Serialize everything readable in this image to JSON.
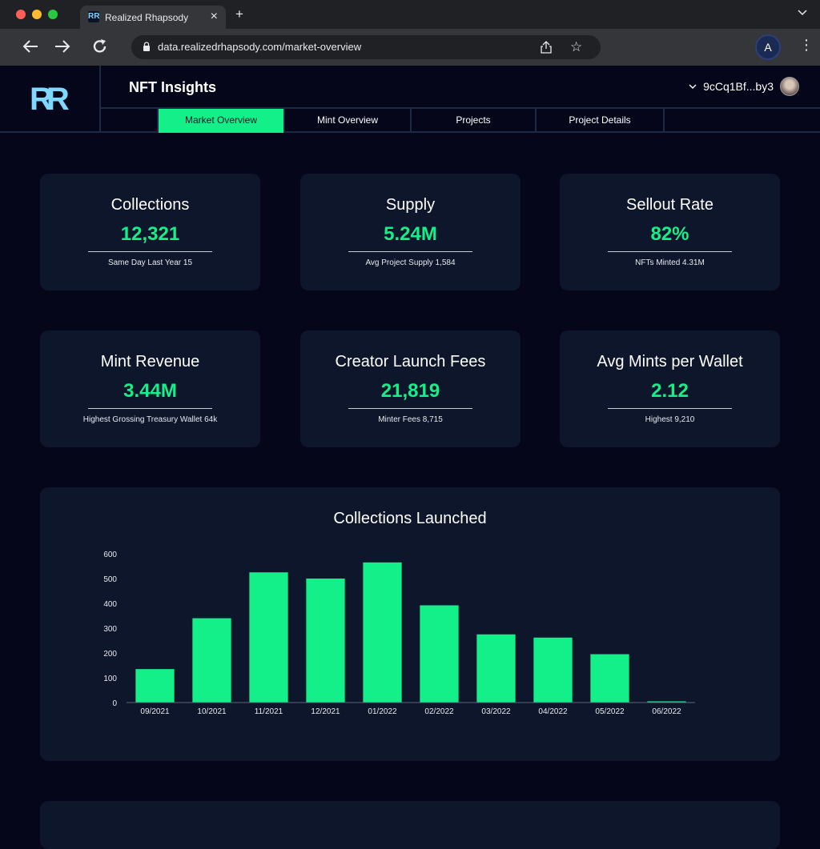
{
  "browser": {
    "tab_title": "Realized Rhapsody",
    "tab_favicon": "RR",
    "url": "data.realizedrhapsody.com/market-overview",
    "profile_initial": "A",
    "colors": {
      "close": "#ff5f57",
      "minimize": "#febc2e",
      "maximize": "#28c840"
    }
  },
  "header": {
    "logo": "RR",
    "title": "NFT Insights",
    "wallet": "9cCq1Bf...by3"
  },
  "nav": {
    "tabs": [
      {
        "label": "Market Overview",
        "active": true
      },
      {
        "label": "Mint Overview",
        "active": false
      },
      {
        "label": "Projects",
        "active": false
      },
      {
        "label": "Project Details",
        "active": false
      }
    ]
  },
  "stats": [
    {
      "title": "Collections",
      "value": "12,321",
      "sub": "Same Day Last Year 15"
    },
    {
      "title": "Supply",
      "value": "5.24M",
      "sub": "Avg Project Supply 1,584"
    },
    {
      "title": "Sellout Rate",
      "value": "82%",
      "sub": "NFTs Minted 4.31M"
    },
    {
      "title": "Mint Revenue",
      "value": "3.44M",
      "sub": "Highest Grossing Treasury Wallet 64k"
    },
    {
      "title": "Creator Launch Fees",
      "value": "21,819",
      "sub": "Minter Fees 8,715"
    },
    {
      "title": "Avg Mints per Wallet",
      "value": "2.12",
      "sub": "Highest 9,210"
    }
  ],
  "accent_color": "#14f089",
  "chart_data": {
    "type": "bar",
    "title": "Collections Launched",
    "categories": [
      "09/2021",
      "10/2021",
      "11/2021",
      "12/2021",
      "01/2022",
      "02/2022",
      "03/2022",
      "04/2022",
      "05/2022",
      "06/2022"
    ],
    "values": [
      135,
      340,
      525,
      500,
      565,
      392,
      275,
      262,
      195,
      5
    ],
    "ylim": [
      0,
      600
    ],
    "yticks": [
      0,
      100,
      200,
      300,
      400,
      500,
      600
    ],
    "xlabel": "",
    "ylabel": "",
    "grid": false,
    "color": "#14f089"
  }
}
